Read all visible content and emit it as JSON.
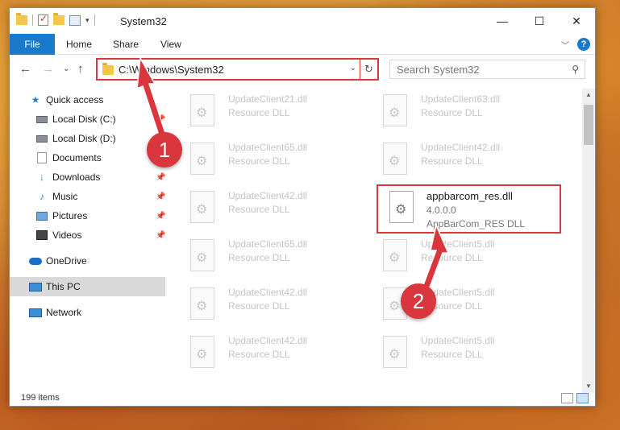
{
  "window": {
    "title": "System32",
    "controls": {
      "minimize": "—",
      "maximize": "☐",
      "close": "✕"
    }
  },
  "ribbon": {
    "tabs": [
      {
        "label": "File",
        "active": true
      },
      {
        "label": "Home"
      },
      {
        "label": "Share"
      },
      {
        "label": "View"
      }
    ]
  },
  "nav": {
    "address": "C:\\Windows\\System32",
    "search_placeholder": "Search System32"
  },
  "sidebar": {
    "items": [
      {
        "label": "Quick access",
        "icon": "star-icon"
      },
      {
        "label": "Local Disk (C:)",
        "icon": "drive-icon",
        "pinned": true
      },
      {
        "label": "Local Disk (D:)",
        "icon": "drive-icon"
      },
      {
        "label": "Documents",
        "icon": "documents-icon"
      },
      {
        "label": "Downloads",
        "icon": "download-icon",
        "pinned": true
      },
      {
        "label": "Music",
        "icon": "music-icon",
        "pinned": true
      },
      {
        "label": "Pictures",
        "icon": "pictures-icon",
        "pinned": true
      },
      {
        "label": "Videos",
        "icon": "videos-icon",
        "pinned": true
      },
      {
        "label": "OneDrive",
        "icon": "cloud-icon"
      },
      {
        "label": "This PC",
        "icon": "computer-icon",
        "selected": true
      },
      {
        "label": "Network",
        "icon": "network-icon"
      }
    ]
  },
  "files": {
    "left_column": [
      {
        "name": "UpdateClient21.dll",
        "type": "Resource DLL"
      },
      {
        "name": "UpdateClient65.dll",
        "type": "Resource DLL"
      },
      {
        "name": "UpdateClient42.dll",
        "type": "Resource DLL"
      },
      {
        "name": "UpdateClient65.dll",
        "type": "Resource DLL"
      },
      {
        "name": "UpdateClient42.dll",
        "type": "Resource DLL"
      },
      {
        "name": "UpdateClient42.dll",
        "type": "Resource DLL"
      }
    ],
    "right_column": [
      {
        "name": "UpdateClient63.dll",
        "type": "Resource DLL"
      },
      {
        "name": "UpdateClient42.dll",
        "type": "Resource DLL"
      },
      {
        "name": "UpdateClient5.dll",
        "type": "Resource DLL"
      },
      {
        "name": "UpdateClient5.dll",
        "type": "Resource DLL"
      },
      {
        "name": "UpdateClient5.dll",
        "type": "Resource DLL"
      }
    ],
    "highlighted": {
      "name": "appbarcom_res.dll",
      "version": "4.0.0.0",
      "type": "AppBarCom_RES DLL"
    }
  },
  "status": {
    "item_count": "199 items"
  },
  "annotations": {
    "step1": "1",
    "step2": "2"
  },
  "colors": {
    "accent": "#1979ca",
    "highlight": "#d9363e"
  }
}
